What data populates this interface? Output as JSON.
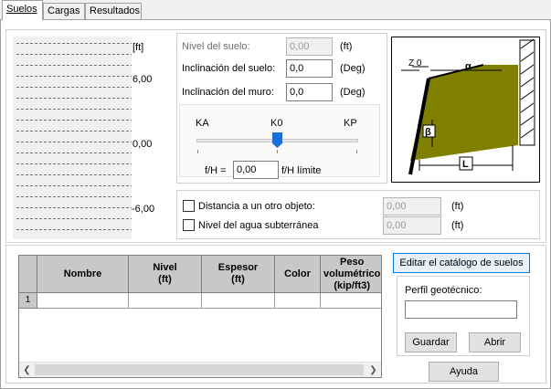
{
  "tabs": [
    {
      "label": "Suelos",
      "active": true
    },
    {
      "label": "Cargas",
      "active": false
    },
    {
      "label": "Resultados",
      "active": false
    }
  ],
  "profile": {
    "unit": "[ft]",
    "ticks": [
      "6,00",
      "0,00",
      "-6,00"
    ]
  },
  "fields": {
    "nivel_suelo": {
      "label": "Nivel del suelo:",
      "value": "0,00",
      "unit": "(ft)",
      "enabled": false
    },
    "inclinacion_suelo": {
      "label": "Inclinación del suelo:",
      "value": "0,0",
      "unit": "(Deg)"
    },
    "inclinacion_muro": {
      "label": "Inclinación del muro:",
      "value": "0,0",
      "unit": "(Deg)"
    }
  },
  "slider": {
    "labels": [
      "KA",
      "K0",
      "KP"
    ],
    "fh_label": "f/H =",
    "fh_value": "0,00",
    "fh_limit_label": "f/H límite",
    "position": 0.5
  },
  "diagram": {
    "z_label": "Z 0",
    "alpha": "α",
    "beta": "β",
    "L": "L",
    "soil_color": "#808000"
  },
  "options": {
    "distancia": {
      "label": "Distancia a un otro objeto:",
      "value": "0,00",
      "unit": "(ft)",
      "checked": false
    },
    "nivel_agua": {
      "label": "Nivel del agua subterránea",
      "value": "0,00",
      "unit": "(ft)",
      "checked": false
    }
  },
  "table": {
    "columns": [
      "Nombre",
      "Nivel\n(ft)",
      "Espesor\n(ft)",
      "Color",
      "Peso\nvolumétrico\n(kip/ft3)"
    ],
    "rows": [
      {
        "index": "1"
      }
    ]
  },
  "right_panel": {
    "edit_catalog": "Editar el catálogo de suelos",
    "perfil_label": "Perfil geotécnico:",
    "perfil_value": "",
    "guardar": "Guardar",
    "abrir": "Abrir",
    "ayuda": "Ayuda"
  },
  "colors": {
    "accent": "#0078d7",
    "thumb": "#1a6ed8",
    "soil": "#808000"
  }
}
